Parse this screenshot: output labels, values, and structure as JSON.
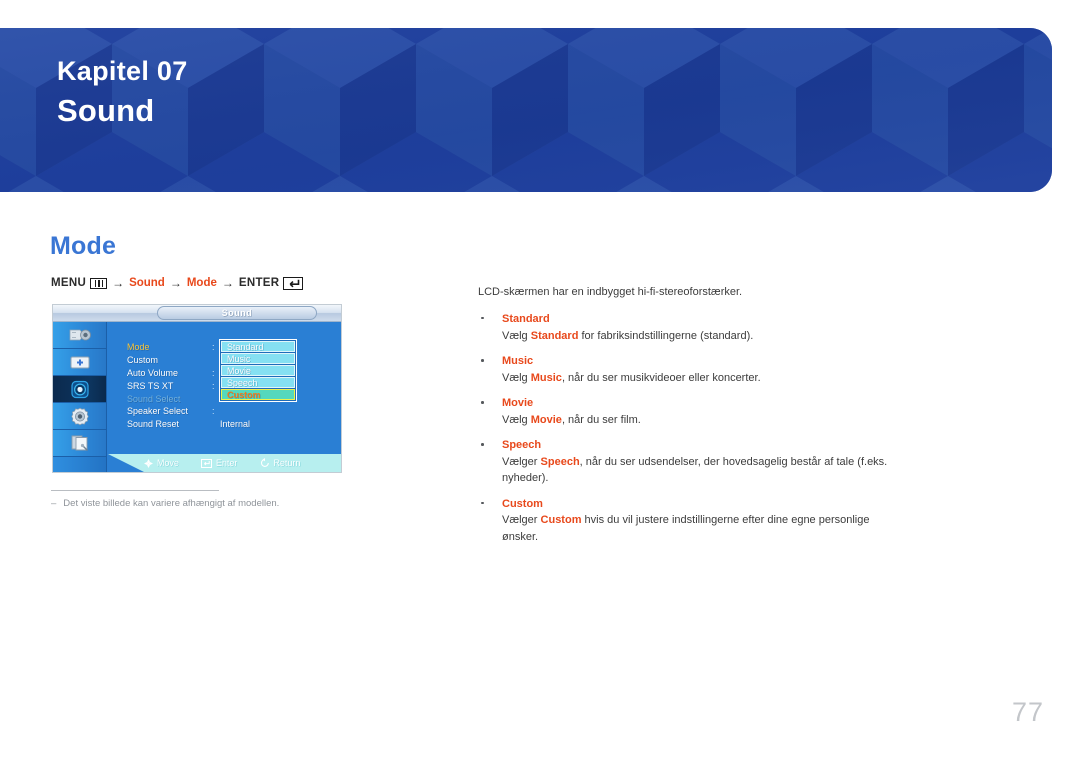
{
  "banner": {
    "chapter_label": "Kapitel 07",
    "chapter_title": "Sound",
    "bg_color": "#1e3f9e"
  },
  "section": {
    "heading": "Mode",
    "heading_color": "#3a76d4"
  },
  "menu_path": {
    "menu_label": "MENU",
    "menu_icon": "menu-bars-icon",
    "arrow": "→",
    "step1": "Sound",
    "step2": "Mode",
    "enter_label": "ENTER",
    "enter_icon": "enter-return-icon",
    "accent_color": "#e8491c"
  },
  "osd": {
    "title": "Sound",
    "sidebar_icons": [
      {
        "name": "input-plug-icon",
        "selected": false
      },
      {
        "name": "picture-screen-icon",
        "selected": false
      },
      {
        "name": "sound-speaker-icon",
        "selected": true
      },
      {
        "name": "setup-gear-icon",
        "selected": false
      },
      {
        "name": "multi-control-page-icon",
        "selected": false
      }
    ],
    "menu_items": [
      {
        "label": "Mode",
        "state": "active"
      },
      {
        "label": "Custom",
        "state": "normal"
      },
      {
        "label": "Auto Volume",
        "state": "normal"
      },
      {
        "label": "SRS TS XT",
        "state": "normal"
      },
      {
        "label": "Sound Select",
        "state": "disabled"
      },
      {
        "label": "Speaker Select",
        "state": "normal"
      },
      {
        "label": "Sound Reset",
        "state": "normal"
      }
    ],
    "speaker_select_value": "Internal",
    "dropdown_options": [
      {
        "label": "Standard",
        "selected": false
      },
      {
        "label": "Music",
        "selected": false
      },
      {
        "label": "Movie",
        "selected": false
      },
      {
        "label": "Speech",
        "selected": false
      },
      {
        "label": "Custom",
        "selected": true
      }
    ],
    "footer": [
      {
        "icon": "move-dpad-icon",
        "label": "Move"
      },
      {
        "icon": "enter-return-icon",
        "label": "Enter"
      },
      {
        "icon": "return-arrow-icon",
        "label": "Return"
      }
    ]
  },
  "footnote": {
    "dash": "–",
    "text": "Det viste billede kan variere afhængigt af modellen."
  },
  "content": {
    "intro": "LCD-skærmen har en indbygget hi-fi-stereoforstærker.",
    "items": [
      {
        "title": "Standard",
        "desc_before": "Vælg ",
        "desc_bold": "Standard",
        "desc_after": " for fabriksindstillingerne (standard)."
      },
      {
        "title": "Music",
        "desc_before": "Vælg ",
        "desc_bold": "Music",
        "desc_after": ", når du ser musikvideoer eller koncerter."
      },
      {
        "title": "Movie",
        "desc_before": "Vælg ",
        "desc_bold": "Movie",
        "desc_after": ", når du ser film."
      },
      {
        "title": "Speech",
        "desc_before": "Vælger ",
        "desc_bold": "Speech",
        "desc_after": ", når du ser udsendelser, der hovedsagelig består af tale (f.eks. nyheder)."
      },
      {
        "title": "Custom",
        "desc_before": "Vælger ",
        "desc_bold": "Custom",
        "desc_after": " hvis du vil justere indstillingerne efter dine egne personlige ønsker."
      }
    ]
  },
  "page_number": "77"
}
